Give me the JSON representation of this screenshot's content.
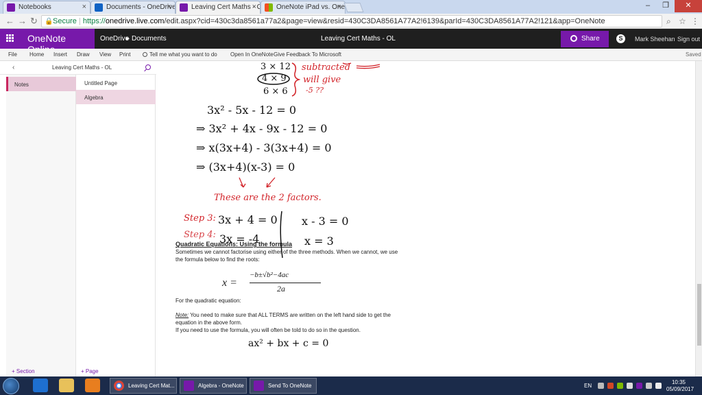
{
  "browser": {
    "tabs": [
      {
        "label": "Notebooks",
        "icon": "onenote-icon",
        "color": "#7719aa"
      },
      {
        "label": "Documents - OneDrive",
        "icon": "onedrive-icon",
        "color": "#0f62c4"
      },
      {
        "label": "Leaving Cert Maths - OL",
        "icon": "onenote-icon",
        "color": "#7719aa"
      },
      {
        "label": "OneNote iPad vs. OneN",
        "icon": "microsoft-icon",
        "color": "#f25022"
      }
    ],
    "url_secure": "Secure",
    "url_scheme": "https://",
    "url_host": "onedrive.live.com",
    "url_path": "/edit.aspx?cid=430c3da8561a77a2&page=view&resid=430C3DA8561A77A2!6139&parId=430C3DA8561A77A2!121&app=OneNote"
  },
  "app": {
    "name": "OneNote Online",
    "breadcrumb": [
      "OneDrive",
      "Documents"
    ],
    "document_title": "Leaving Cert Maths - OL",
    "share_label": "Share",
    "user_name": "Mark Sheehan",
    "sign_out": "Sign out",
    "accent_color": "#7719aa"
  },
  "ribbon": {
    "items": [
      "File",
      "Home",
      "Insert",
      "Draw",
      "View",
      "Print"
    ],
    "tell_me": "Tell me what you want to do",
    "open_in": "Open In OneNote",
    "feedback": "Give Feedback To Microsoft",
    "status": "Saved"
  },
  "nav": {
    "notebook_name": "Leaving Cert Maths - OL",
    "sections": [
      {
        "label": "Notes",
        "selected": true
      }
    ],
    "pages": [
      {
        "label": "Untitled Page",
        "selected": false
      },
      {
        "label": "Algebra",
        "selected": true
      }
    ],
    "add_section": "+ Section",
    "add_page": "+ Page"
  },
  "note": {
    "ink_lines": [
      {
        "text": "3 × 12",
        "color": "black"
      },
      {
        "text": "4 × 9",
        "color": "black"
      },
      {
        "text": "6 × 6",
        "color": "black"
      },
      {
        "text": "subtracted",
        "color": "red"
      },
      {
        "text": "will give",
        "color": "red"
      },
      {
        "text": "-5 ??",
        "color": "red"
      },
      {
        "text": "3x² - 5x - 12 = 0",
        "color": "black"
      },
      {
        "text": "⇒ 3x² + 4x - 9x - 12 = 0",
        "color": "black"
      },
      {
        "text": "⇒ x(3x+4) - 3(3x+4) = 0",
        "color": "black"
      },
      {
        "text": "⇒ (3x+4)(x-3) = 0",
        "color": "black"
      },
      {
        "text": "These are the 2 factors.",
        "color": "red"
      },
      {
        "text": "Step 3:",
        "color": "red"
      },
      {
        "text": "3x + 4 = 0",
        "color": "black"
      },
      {
        "text": "x - 3 = 0",
        "color": "black"
      },
      {
        "text": "Step 4:",
        "color": "red"
      },
      {
        "text": "3x = -4",
        "color": "black"
      },
      {
        "text": "x = 3",
        "color": "black"
      },
      {
        "text": "ax² + bx + c = 0",
        "color": "black"
      }
    ],
    "typed": {
      "heading": "Quadratic Equations: Using the formula",
      "para1_line1": "Sometimes we cannot factorise using either of the three methods. When we cannot, we use",
      "para1_line2": "the formula below to find the roots:",
      "formula_lhs": "x =",
      "formula_num": "−b±√b²−4ac",
      "formula_den": "2a",
      "for_eq": "For the quadratic equation:",
      "note_label": "Note:",
      "note_line1": " You need to make sure that ALL TERMS are written on the left hand side to get the",
      "note_line2": "equation in the above form.",
      "note_line3": "If you need to use the formula, you will often be told to do so in the question."
    }
  },
  "taskbar": {
    "tasks": [
      {
        "label": "Leaving Cert Mat...",
        "icon": "chrome-icon"
      },
      {
        "label": "Algebra - OneNote",
        "icon": "onenote-icon"
      },
      {
        "label": "Send To OneNote",
        "icon": "onenote-icon"
      }
    ],
    "language": "EN",
    "time": "10:35",
    "date": "05/09/2017"
  }
}
